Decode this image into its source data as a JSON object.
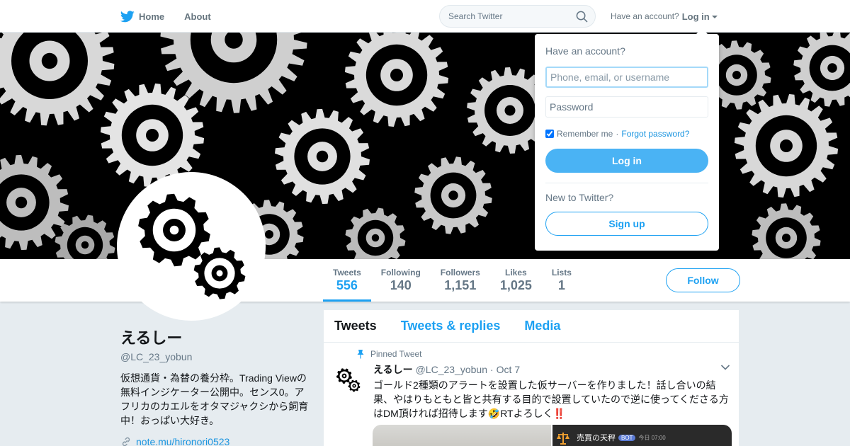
{
  "nav": {
    "home_label": "Home",
    "about_label": "About",
    "search_placeholder": "Search Twitter",
    "have_account_label": "Have an account?",
    "login_label": "Log in",
    "brand_color": "#1da1f2"
  },
  "login_dropdown": {
    "title": "Have an account?",
    "username_placeholder": "Phone, email, or username",
    "password_placeholder": "Password",
    "remember_label": "Remember me",
    "remember_checked": true,
    "separator": "·",
    "forgot_label": "Forgot password?",
    "login_button": "Log in",
    "new_label": "New to Twitter?",
    "signup_button": "Sign up"
  },
  "profile": {
    "name": "えるしー",
    "handle": "@LC_23_yobun",
    "bio": "仮想通貨・為替の養分枠。Trading Viewの無料インジケーター公開中。センス0。アフリカのカエルをオタマジャクシから飼育中！おっぱい大好き。",
    "link": "note.mu/hironori0523",
    "banner_theme": "gears-icon",
    "avatar_icon": "gears-icon"
  },
  "stats": [
    {
      "label": "Tweets",
      "value": "556",
      "active": true
    },
    {
      "label": "Following",
      "value": "140",
      "active": false
    },
    {
      "label": "Followers",
      "value": "1,151",
      "active": false
    },
    {
      "label": "Likes",
      "value": "1,025",
      "active": false
    },
    {
      "label": "Lists",
      "value": "1",
      "active": false
    }
  ],
  "follow_button": "Follow",
  "timeline": {
    "tabs": [
      {
        "label": "Tweets",
        "active": true
      },
      {
        "label": "Tweets & replies",
        "active": false
      },
      {
        "label": "Media",
        "active": false
      }
    ],
    "pinned_tweet": {
      "pinned_label": "Pinned Tweet",
      "name": "えるしー",
      "handle": "@LC_23_yobun",
      "dot": "·",
      "date": "Oct 7",
      "text": "ゴールド2種類のアラートを設置した仮サーバーを作りました！話し合いの結果、やはりもともと皆と共有する目的で設置していたので逆に使ってくださる方はDM頂ければ招待します🤣RTよろしく‼️",
      "media_card_title": "売買の天秤",
      "media_card_badge": "BOT",
      "media_card_time": "今日 07:00"
    }
  }
}
